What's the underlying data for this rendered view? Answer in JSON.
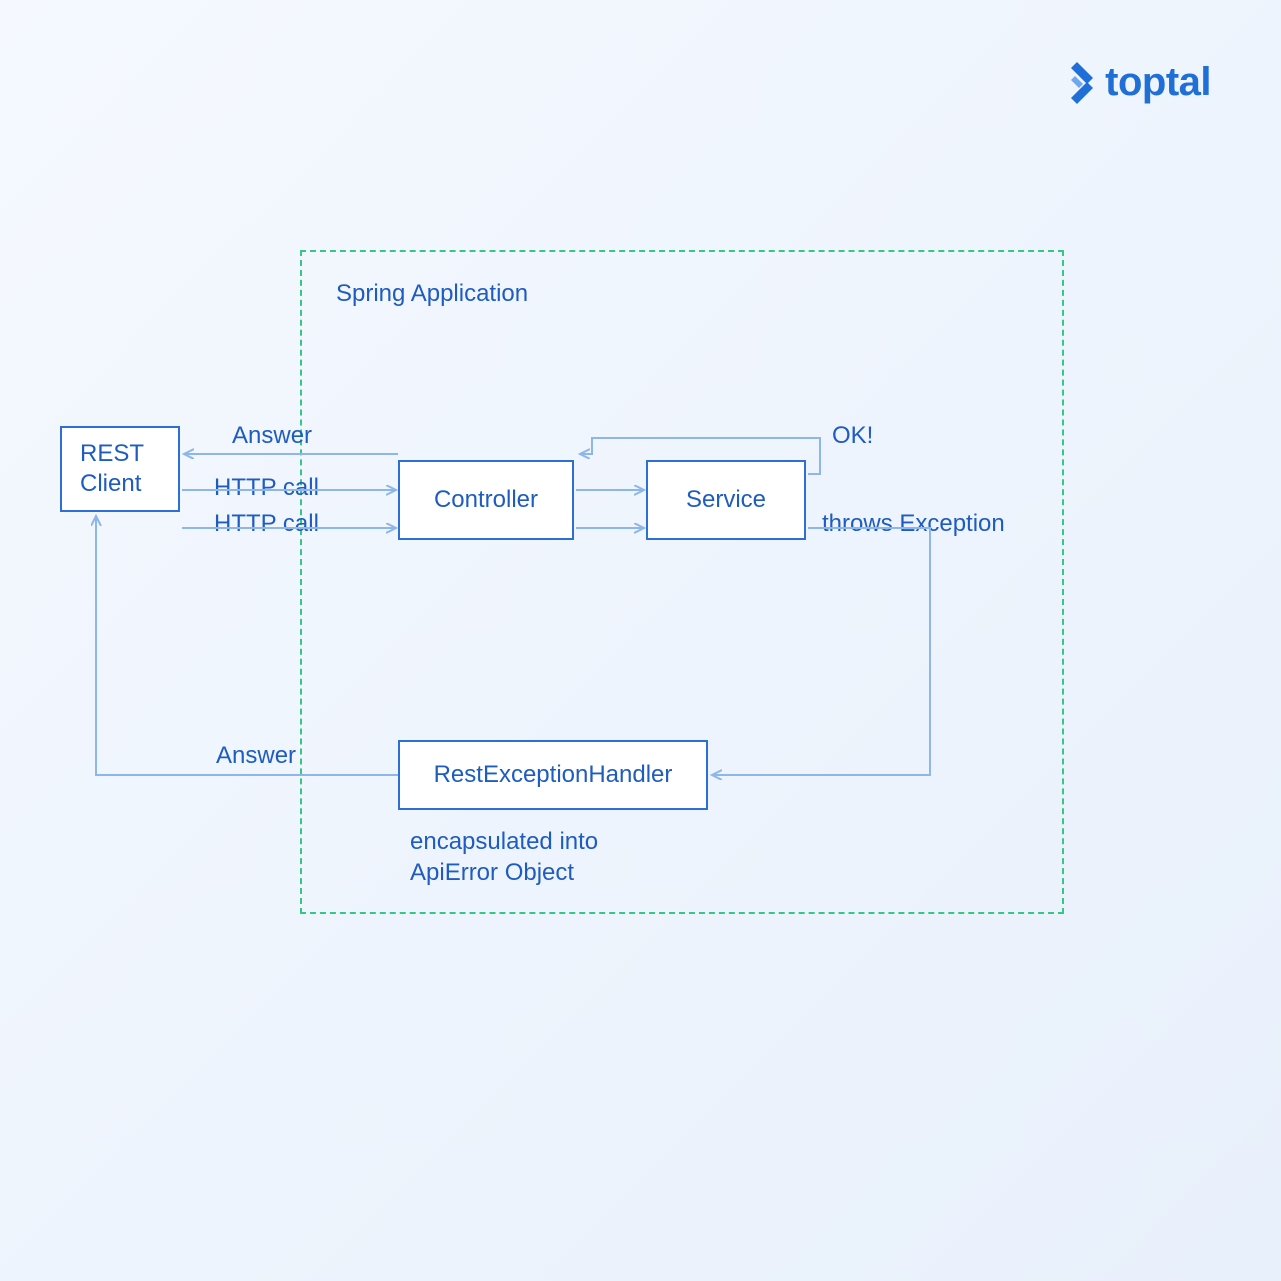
{
  "brand": {
    "name": "toptal"
  },
  "container": {
    "title": "Spring Application"
  },
  "nodes": {
    "rest_client": "REST\nClient",
    "controller": "Controller",
    "service": "Service",
    "rest_exception_handler": "RestExceptionHandler"
  },
  "labels": {
    "answer_top": "Answer",
    "http_call_1": "HTTP call",
    "http_call_2": "HTTP call",
    "ok": "OK!",
    "throws_exception": "throws Exception",
    "answer_bottom": "Answer",
    "encapsulated": "encapsulated into\nApiError Object"
  },
  "colors": {
    "line": "#8db6ea",
    "box_border": "#2d6fd4",
    "text": "#1f5cc0",
    "dash": "#35c885"
  }
}
